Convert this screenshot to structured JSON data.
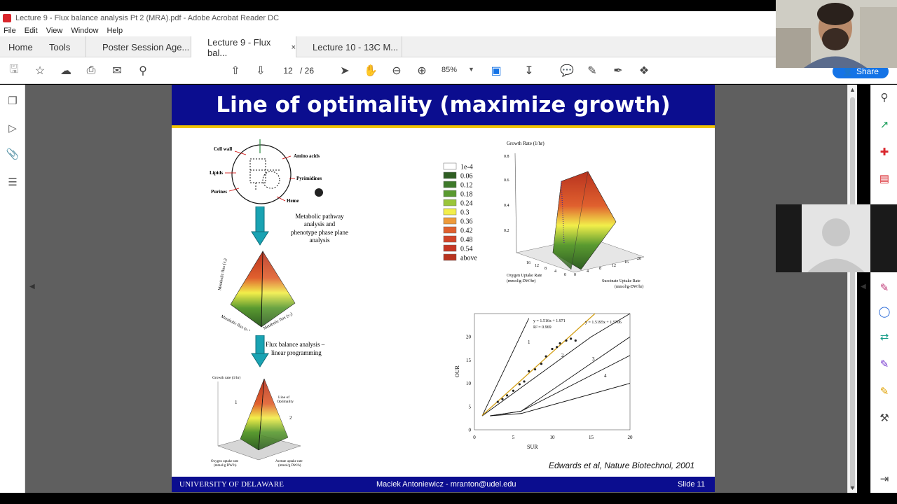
{
  "window": {
    "title": "Lecture 9 - Flux balance analysis Pt 2 (MRA).pdf - Adobe Acrobat Reader DC"
  },
  "menu": [
    "File",
    "Edit",
    "View",
    "Window",
    "Help"
  ],
  "tabs": {
    "home": "Home",
    "tools": "Tools",
    "docs": [
      {
        "label": "Poster Session Age...",
        "active": false
      },
      {
        "label": "Lecture 9 - Flux bal...",
        "active": true,
        "close": "×"
      },
      {
        "label": "Lecture 10 - 13C M...",
        "active": false
      }
    ]
  },
  "toolbar": {
    "page_current": "12",
    "page_total": "/ 26",
    "zoom": "85%",
    "share": "Share"
  },
  "slide": {
    "title": "Line of optimality (maximize growth)",
    "citation": "Edwards et al, Nature Biotechnol, 2001",
    "footer_university": "UNIVERSITY OF DELAWARE",
    "footer_author": "Maciek Antoniewicz  -  mranton@udel.edu",
    "footer_slide": "Slide 11",
    "cell_labels": {
      "cell_wall": "Cell wall",
      "amino_acids": "Amino acids",
      "lipids": "Lipids",
      "pyrimidines": "Pyrimidines",
      "purines": "Purines",
      "heme": "Heme"
    },
    "step1_text": [
      "Metabolic pathway",
      "analysis and",
      "phenotype phase plane",
      "analysis"
    ],
    "step2_text": [
      "Flux balance analysis  –",
      "linear programming"
    ],
    "mid_axes": {
      "y": "Metabolic flux (v₃)",
      "x1": "Metabolic flux (v₁)",
      "x2": "Metabolic flux (v₂)"
    },
    "small_plot": {
      "title": "Growth rate (1/hr)",
      "line_label": [
        "Line of",
        "Optimality"
      ],
      "region1": "1",
      "region2": "2",
      "x1_label": [
        "Oxygen uptake rate",
        "(mmol/g DW/h)"
      ],
      "x2_label": [
        "Acetate uptake rate",
        "(mmol/g DW/h)"
      ]
    },
    "legend": {
      "entries": [
        {
          "label": "1e-4",
          "color": "#ffffff"
        },
        {
          "label": "0.06",
          "color": "#2f5e23"
        },
        {
          "label": "0.12",
          "color": "#3e7a2a"
        },
        {
          "label": "0.18",
          "color": "#5a9a30"
        },
        {
          "label": "0.24",
          "color": "#9ac53a"
        },
        {
          "label": "0.3",
          "color": "#f2ee4a"
        },
        {
          "label": "0.36",
          "color": "#ee9a3a"
        },
        {
          "label": "0.42",
          "color": "#e0602e"
        },
        {
          "label": "0.48",
          "color": "#d24428"
        },
        {
          "label": "0.54",
          "color": "#c63624"
        },
        {
          "label": "above",
          "color": "#b8331f"
        }
      ]
    },
    "surface_plot": {
      "zlabel": "Growth Rate (1/hr)",
      "zticks": [
        "0.8",
        "0.6",
        "0.4",
        "0.2"
      ],
      "x_ticks": [
        "16",
        "12",
        "8",
        "4",
        "0"
      ],
      "y_ticks": [
        "0",
        "4",
        "8",
        "12",
        "16",
        "20"
      ],
      "xlabel": [
        "Oxygen Uptake Rate",
        "(mmol/g-DW/hr)"
      ],
      "ylabel": [
        "Succinate Uptake Rate",
        "(mmol/g-DW/hr)"
      ]
    }
  },
  "chart_data": {
    "type": "scatter",
    "xlabel": "SUR",
    "ylabel": "OUR",
    "xlim": [
      0,
      20
    ],
    "ylim": [
      0,
      25
    ],
    "xticks": [
      "0",
      "5",
      "10",
      "15",
      "20"
    ],
    "yticks": [
      "0",
      "5",
      "10",
      "15",
      "20"
    ],
    "annotations": [
      "y = 1.516x + 1.971",
      "R² = 0.969",
      "y = 1.5195x + 1.5706"
    ],
    "region_labels": [
      "1",
      "2",
      "3",
      "4"
    ],
    "boundaries": [
      {
        "name": "",
        "x": [
          1,
          7
        ],
        "y": [
          3,
          24
        ]
      },
      {
        "name": "",
        "x": [
          1,
          15,
          20
        ],
        "y": [
          3,
          20,
          25
        ]
      },
      {
        "name": "",
        "x": [
          2,
          6,
          20
        ],
        "y": [
          3,
          4,
          20
        ]
      },
      {
        "name": "",
        "x": [
          2,
          6,
          20
        ],
        "y": [
          3,
          4,
          16
        ]
      },
      {
        "name": "",
        "x": [
          2,
          6,
          20
        ],
        "y": [
          3,
          3.5,
          10
        ]
      }
    ],
    "fit_line": {
      "name": "",
      "x": [
        1,
        15.5
      ],
      "y": [
        3.1,
        25
      ]
    },
    "points": {
      "x": [
        3.0,
        3.6,
        4.2,
        5.0,
        5.8,
        6.4,
        7.0,
        7.8,
        8.6,
        9.2,
        10.0,
        10.6,
        11.0,
        11.8,
        12.4,
        13.0
      ],
      "y": [
        6.0,
        6.6,
        7.4,
        8.4,
        9.8,
        10.4,
        12.6,
        13.0,
        14.2,
        15.8,
        17.4,
        17.8,
        18.6,
        19.2,
        19.6,
        19.2
      ]
    }
  }
}
